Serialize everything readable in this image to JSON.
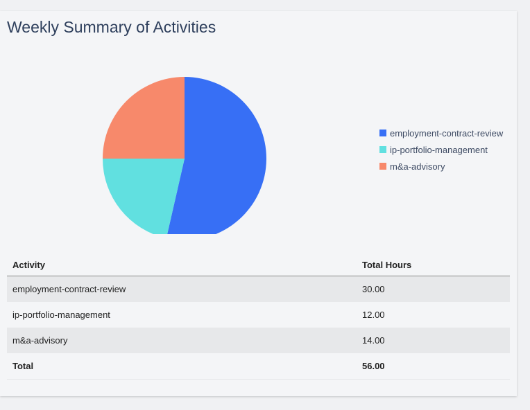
{
  "title": "Weekly Summary of Activities",
  "chart_data": {
    "type": "pie",
    "title": "Weekly Summary of Activities",
    "categories": [
      "employment-contract-review",
      "ip-portfolio-management",
      "m&a-advisory"
    ],
    "values": [
      30,
      12,
      14
    ],
    "colors": [
      "#376ff5",
      "#61e0e0",
      "#f7896b"
    ],
    "legend_position": "right"
  },
  "table": {
    "headers": [
      "Activity",
      "Total Hours"
    ],
    "rows": [
      [
        "employment-contract-review",
        "30.00"
      ],
      [
        "ip-portfolio-management",
        "12.00"
      ],
      [
        "m&a-advisory",
        "14.00"
      ]
    ],
    "total": [
      "Total",
      "56.00"
    ]
  }
}
